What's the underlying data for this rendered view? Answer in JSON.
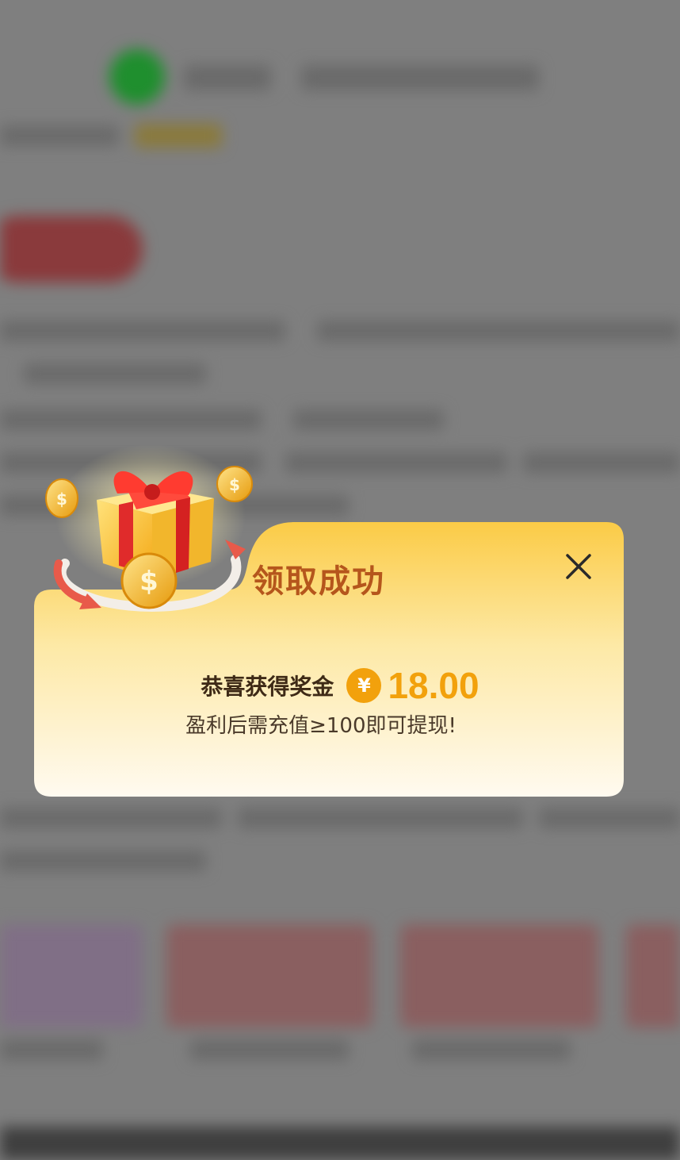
{
  "dialog": {
    "title": "领取成功",
    "prize_label": "恭喜获得奖金",
    "currency_symbol": "¥",
    "prize_amount": "18.00",
    "note": "盈利后需充值≥100即可提现!",
    "close_icon": "close-icon",
    "illustration": "gift-box-with-coins"
  },
  "colors": {
    "title": "#b5561c",
    "amount": "#f2a10c",
    "card_top": "#fbd45c",
    "card_bottom": "#fff9ea",
    "overlay": "#7f7f7f"
  }
}
